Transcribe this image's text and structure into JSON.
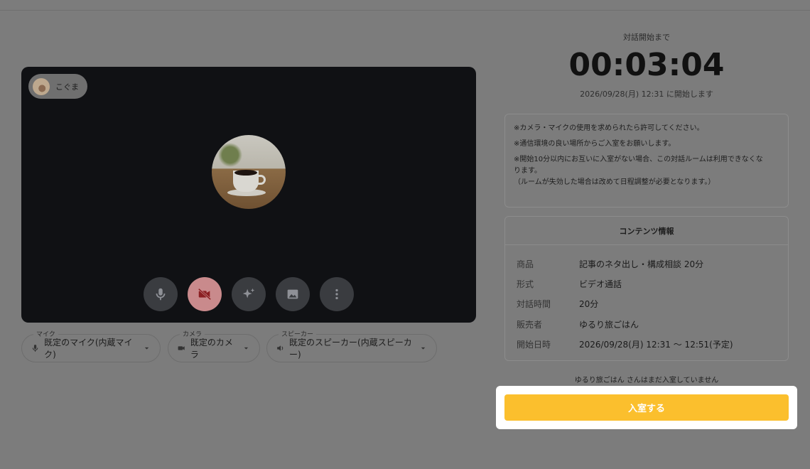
{
  "countdown": {
    "label": "対話開始まで",
    "time": "00:03:04",
    "start_note": "2026/09/28(月) 12:31 に開始します"
  },
  "video": {
    "participant_name": "こぐま",
    "controls": [
      {
        "icon": "mic-icon"
      },
      {
        "icon": "camera-off-icon"
      },
      {
        "icon": "sparkle-effects-icon"
      },
      {
        "icon": "image-background-icon"
      },
      {
        "icon": "more-vertical-icon"
      }
    ]
  },
  "devices": {
    "mic": {
      "label": "マイク",
      "value": "既定のマイク(内蔵マイク)"
    },
    "camera": {
      "label": "カメラ",
      "value": "既定のカメラ"
    },
    "speaker": {
      "label": "スピーカー",
      "value": "既定のスピーカー(内蔵スピーカー)"
    }
  },
  "notice": {
    "line1": "※カメラ・マイクの使用を求められたら許可してください。",
    "line2": "※通信環境の良い場所からご入室をお願いします。",
    "line3a": "※開始10分以内にお互いに入室がない場合、この対話ルームは利用できなくな",
    "line3b": "ります。",
    "line4": "（ルームが失効した場合は改めて日程調整が必要となります。）"
  },
  "content_info": {
    "title": "コンテンツ情報",
    "rows": [
      {
        "key": "商品",
        "value": "記事のネタ出し・構成相談 20分"
      },
      {
        "key": "形式",
        "value": "ビデオ通話"
      },
      {
        "key": "対話時間",
        "value": "20分"
      },
      {
        "key": "販売者",
        "value": "ゆるり旅ごはん"
      },
      {
        "key": "開始日時",
        "value": "2026/09/28(月) 12:31 〜 12:51(予定)"
      }
    ]
  },
  "status": {
    "not_entered": "ゆるり旅ごはん さんはまだ入室していません"
  },
  "enter_button": {
    "label": "入室する"
  },
  "colors": {
    "accent": "#fbbf2d",
    "video_bg": "#101114",
    "overlay": "#7c7c7c",
    "camera_off": "#c98a8c"
  }
}
